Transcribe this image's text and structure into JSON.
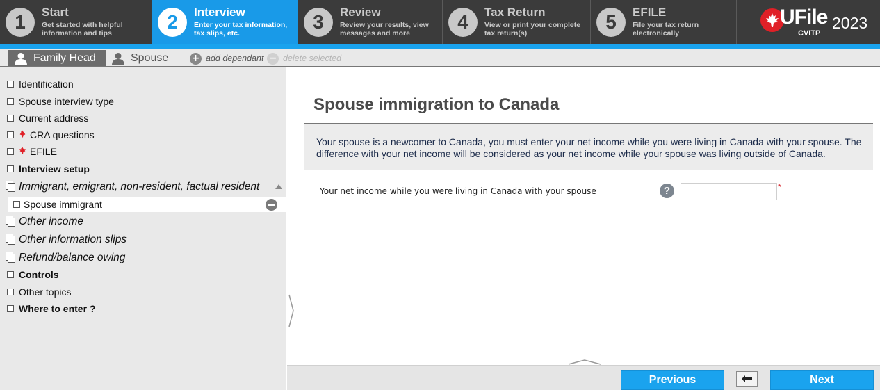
{
  "steps": [
    {
      "number": "1",
      "title": "Start",
      "description": "Get started with helpful information and tips",
      "active": false
    },
    {
      "number": "2",
      "title": "Interview",
      "description": "Enter your tax information, tax slips, etc.",
      "active": true
    },
    {
      "number": "3",
      "title": "Review",
      "description": "Review your results, view messages and more",
      "active": false
    },
    {
      "number": "4",
      "title": "Tax Return",
      "description": "View or print your complete tax return(s)",
      "active": false
    },
    {
      "number": "5",
      "title": "EFILE",
      "description": "File your tax return electronically",
      "active": false
    }
  ],
  "logo": {
    "brand": "UFile",
    "year": "2023",
    "subtitle": "CVITP"
  },
  "person_tabs": {
    "family_head": "Family Head",
    "spouse": "Spouse",
    "add_dependant": "add dependant",
    "delete_selected": "delete selected"
  },
  "nav": {
    "identification": "Identification",
    "spouse_interview_type": "Spouse interview type",
    "current_address": "Current address",
    "cra_questions": "CRA questions",
    "efile": "EFILE",
    "interview_setup": "Interview setup",
    "immigrant_group": "Immigrant, emigrant, non-resident, factual resident",
    "spouse_immigrant": "Spouse immigrant",
    "other_income": "Other income",
    "other_information_slips": "Other information slips",
    "refund_balance_owing": "Refund/balance owing",
    "controls": "Controls",
    "other_topics": "Other topics",
    "where_to_enter": "Where to enter ?"
  },
  "main": {
    "title": "Spouse immigration to Canada",
    "info": "Your spouse is a newcomer to Canada, you must enter your net income while you were living in Canada with your spouse. The difference with your net income will be considered as your net income while your spouse was living outside of Canada.",
    "field_label": "Your net income while you were living in Canada with your spouse",
    "field_value": "",
    "help_label": "?",
    "required_mark": "*"
  },
  "footer": {
    "previous": "Previous",
    "next": "Next"
  },
  "colors": {
    "accent_blue": "#199ae8",
    "dark_bar": "#3b3b3b",
    "maple_red": "#e02027",
    "required_red": "#d6242b"
  }
}
